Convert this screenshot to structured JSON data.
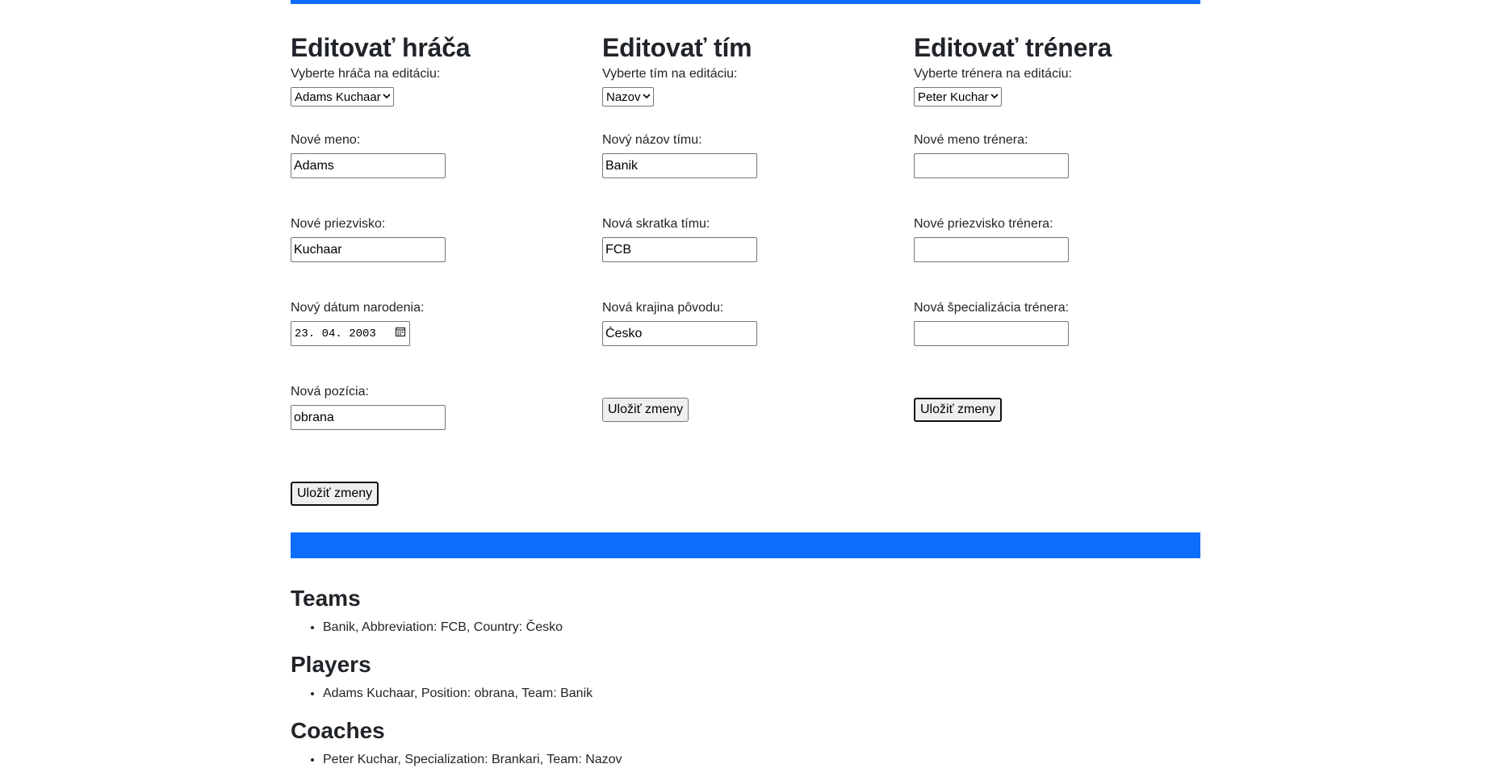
{
  "player_form": {
    "title": "Editovať hráča",
    "select_label": "Vyberte hráča na editáciu:",
    "selected": "Adams Kuchaar",
    "name_label": "Nové meno:",
    "name_value": "Adams",
    "surname_label": "Nové priezvisko:",
    "surname_value": "Kuchaar",
    "birth_label": "Nový dátum narodenia:",
    "birth_value": "23. 04. 2003",
    "position_label": "Nová pozícia:",
    "position_value": "obrana",
    "save_label": "Uložiť zmeny"
  },
  "team_form": {
    "title": "Editovať tím",
    "select_label": "Vyberte tím na editáciu:",
    "selected": "Nazov",
    "name_label": "Nový názov tímu:",
    "name_value": "Banik",
    "abbr_label": "Nová skratka tímu:",
    "abbr_value": "FCB",
    "country_label": "Nová krajina pôvodu:",
    "country_value": "Česko",
    "save_label": "Uložiť zmeny"
  },
  "coach_form": {
    "title": "Editovať trénera",
    "select_label": "Vyberte trénera na editáciu:",
    "selected": "Peter Kuchar",
    "name_label": "Nové meno trénera:",
    "name_value": "",
    "surname_label": "Nové priezvisko trénera:",
    "surname_value": "",
    "spec_label": "Nová špecializácia trénera:",
    "spec_value": "",
    "save_label": "Uložiť zmeny"
  },
  "lists": {
    "teams_title": "Teams",
    "teams": [
      "Banik, Abbreviation: FCB, Country: Česko"
    ],
    "players_title": "Players",
    "players": [
      "Adams Kuchaar, Position: obrana, Team: Banik"
    ],
    "coaches_title": "Coaches",
    "coaches": [
      "Peter Kuchar, Specialization: Brankari, Team: Nazov"
    ]
  },
  "colors": {
    "accent": "#0d6efd",
    "text": "#212529"
  }
}
